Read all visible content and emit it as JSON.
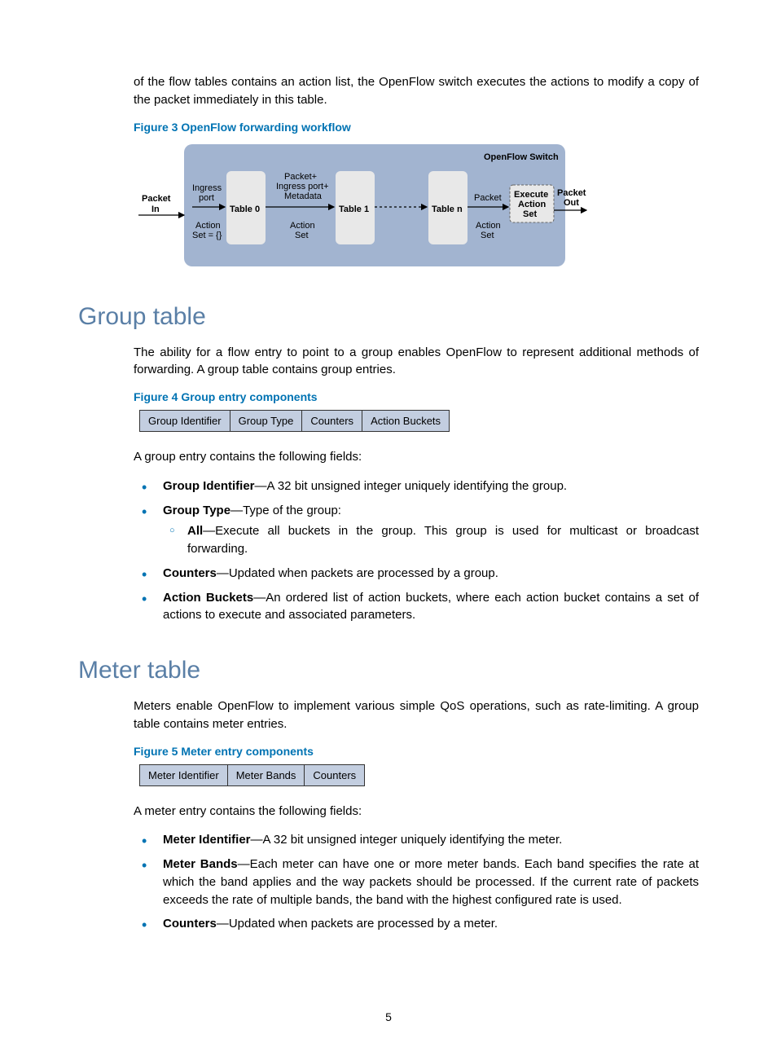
{
  "intro_paragraph": "of the flow tables contains an action list, the OpenFlow switch executes the actions to modify a copy of the packet immediately in this table.",
  "figure3_caption": "Figure 3 OpenFlow forwarding workflow",
  "diagram": {
    "switch_title": "OpenFlow Switch",
    "packet_in": "Packet",
    "packet_in2": "In",
    "packet_out": "Packet",
    "packet_out2": "Out",
    "ingress1": "Ingress",
    "ingress2": "port",
    "ingress3": "Action",
    "ingress4": "Set = {}",
    "table0": "Table 0",
    "mid1": "Packet+",
    "mid2": "Ingress port+",
    "mid3": "Metadata",
    "mid4": "Action",
    "mid5": "Set",
    "table1": "Table 1",
    "tablen": "Table n",
    "n1": "Packet",
    "n2": "Action",
    "n3": "Set",
    "exec1": "Execute",
    "exec2": "Action",
    "exec3": "Set"
  },
  "group_heading": "Group table",
  "group_intro": "The ability for a flow entry to point to a group enables OpenFlow to represent additional methods of forwarding. A group table contains group entries.",
  "figure4_caption": "Figure 4 Group entry components",
  "figure4_cells": [
    "Group Identifier",
    "Group Type",
    "Counters",
    "Action Buckets"
  ],
  "group_fields_intro": "A group entry contains the following fields:",
  "group_bullets": {
    "b1_label": "Group Identifier",
    "b1_text": "—A 32 bit unsigned integer uniquely identifying the group.",
    "b2_label": "Group Type",
    "b2_text": "—Type of the group:",
    "b2_sub_label": "All",
    "b2_sub_text": "—Execute all buckets in the group. This group is used for multicast or broadcast forwarding.",
    "b3_label": "Counters",
    "b3_text": "—Updated when packets are processed by a group.",
    "b4_label": "Action Buckets",
    "b4_text": "—An ordered list of action buckets, where each action bucket contains a set of actions to execute and associated parameters."
  },
  "meter_heading": "Meter table",
  "meter_intro": "Meters enable OpenFlow to implement various simple QoS operations, such as rate-limiting. A group table contains meter entries.",
  "figure5_caption": "Figure 5 Meter entry components",
  "figure5_cells": [
    "Meter Identifier",
    "Meter Bands",
    "Counters"
  ],
  "meter_fields_intro": "A meter entry contains the following fields:",
  "meter_bullets": {
    "b1_label": "Meter Identifier",
    "b1_text": "—A 32 bit unsigned integer uniquely identifying the meter.",
    "b2_label": "Meter Bands",
    "b2_text": "—Each meter can have one or more meter bands. Each band specifies the rate at which the band applies and the way packets should be processed. If the current rate of packets exceeds the rate of multiple bands, the band with the highest configured rate is used.",
    "b3_label": "Counters",
    "b3_text": "—Updated when packets are processed by a meter."
  },
  "page_number": "5"
}
